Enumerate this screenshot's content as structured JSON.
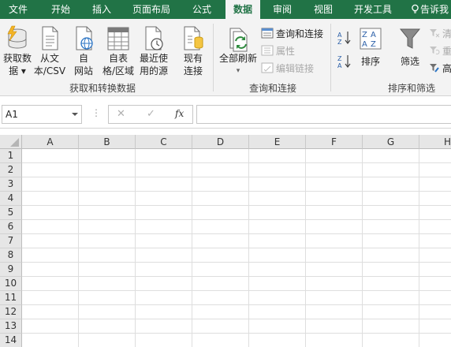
{
  "tabs": [
    {
      "label": "文件",
      "active": false
    },
    {
      "label": "开始",
      "active": false
    },
    {
      "label": "插入",
      "active": false
    },
    {
      "label": "页面布局",
      "active": false
    },
    {
      "label": "公式",
      "active": false
    },
    {
      "label": "数据",
      "active": true
    },
    {
      "label": "审阅",
      "active": false
    },
    {
      "label": "视图",
      "active": false
    },
    {
      "label": "开发工具",
      "active": false
    }
  ],
  "tell_me": "告诉我",
  "ribbon": {
    "get_transform": {
      "group_label": "获取和转换数据",
      "get_data": [
        "获取数",
        "据 ▾"
      ],
      "from_text": [
        "从文",
        "本/CSV"
      ],
      "from_web": [
        "自",
        "网站"
      ],
      "from_table": [
        "自表",
        "格/区域"
      ],
      "recent_sources": [
        "最近使",
        "用的源"
      ]
    },
    "existing": [
      "现有",
      "连接"
    ],
    "queries": {
      "group_label": "查询和连接",
      "refresh_all": [
        "全部刷新",
        "▾"
      ],
      "queries_connections": "查询和连接",
      "properties": "属性",
      "edit_links": "编辑链接"
    },
    "sort_filter": {
      "group_label": "排序和筛选",
      "sort": "排序",
      "filter": "筛选",
      "clear": "清",
      "reapply": "重",
      "advanced": "高"
    }
  },
  "formula_bar": {
    "name_box": "A1",
    "cancel": "✕",
    "enter": "✓",
    "fx": "fx",
    "content": ""
  },
  "grid": {
    "columns": [
      "A",
      "B",
      "C",
      "D",
      "E",
      "F",
      "G",
      "H"
    ],
    "rows": [
      "1",
      "2",
      "3",
      "4",
      "5",
      "6",
      "7",
      "8",
      "9",
      "10",
      "11",
      "12",
      "13",
      "14"
    ]
  },
  "colors": {
    "accent": "#217346"
  }
}
